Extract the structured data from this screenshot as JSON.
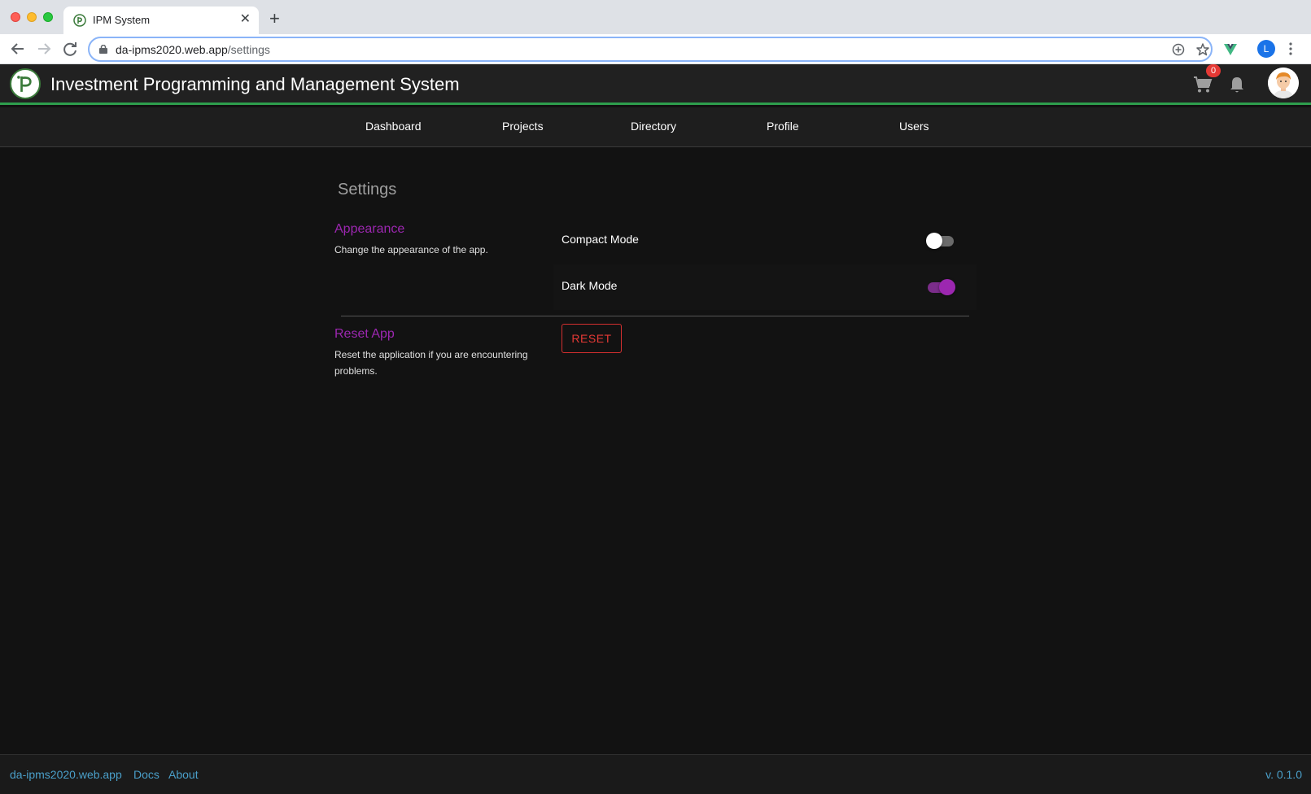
{
  "browser": {
    "tab_title": "IPM System",
    "url_host": "da-ipms2020.web.app",
    "url_path": "/settings",
    "profile_initial": "L"
  },
  "header": {
    "app_title": "Investment Programming and Management System",
    "cart_count": "0"
  },
  "nav": {
    "items": [
      "Dashboard",
      "Projects",
      "Directory",
      "Profile",
      "Users"
    ]
  },
  "settings": {
    "title": "Settings",
    "appearance": {
      "title": "Appearance",
      "description": "Change the appearance of the app.",
      "compact_mode_label": "Compact Mode",
      "compact_mode_on": false,
      "dark_mode_label": "Dark Mode",
      "dark_mode_on": true
    },
    "reset": {
      "title": "Reset App",
      "description": "Reset the application if you are encountering problems.",
      "button_label": "RESET"
    }
  },
  "footer": {
    "links": [
      "da-ipms2020.web.app",
      "Docs",
      "About"
    ],
    "version": "v. 0.1.0"
  },
  "colors": {
    "accent": "#9c27b0",
    "header_border": "#2e9e4d",
    "danger": "#e53935",
    "footer_link": "#4a9fc9"
  }
}
